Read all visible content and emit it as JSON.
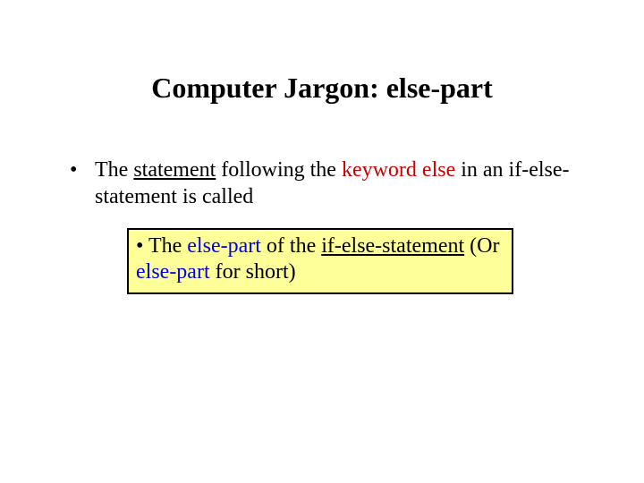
{
  "title": "Computer Jargon: else-part",
  "bullet": {
    "mark": "•",
    "t1": "The ",
    "t2_u": "statement",
    "t3": " following the ",
    "t4_red": "keyword else",
    "t5": " in an if-else-statement is called"
  },
  "callout": {
    "c1": "• The ",
    "c2_blue": "else-part",
    "c3": " of the ",
    "c4_u": "if-else-statement",
    "c5": " (Or ",
    "c6_blue": "else-part",
    "c7": " for short)"
  }
}
